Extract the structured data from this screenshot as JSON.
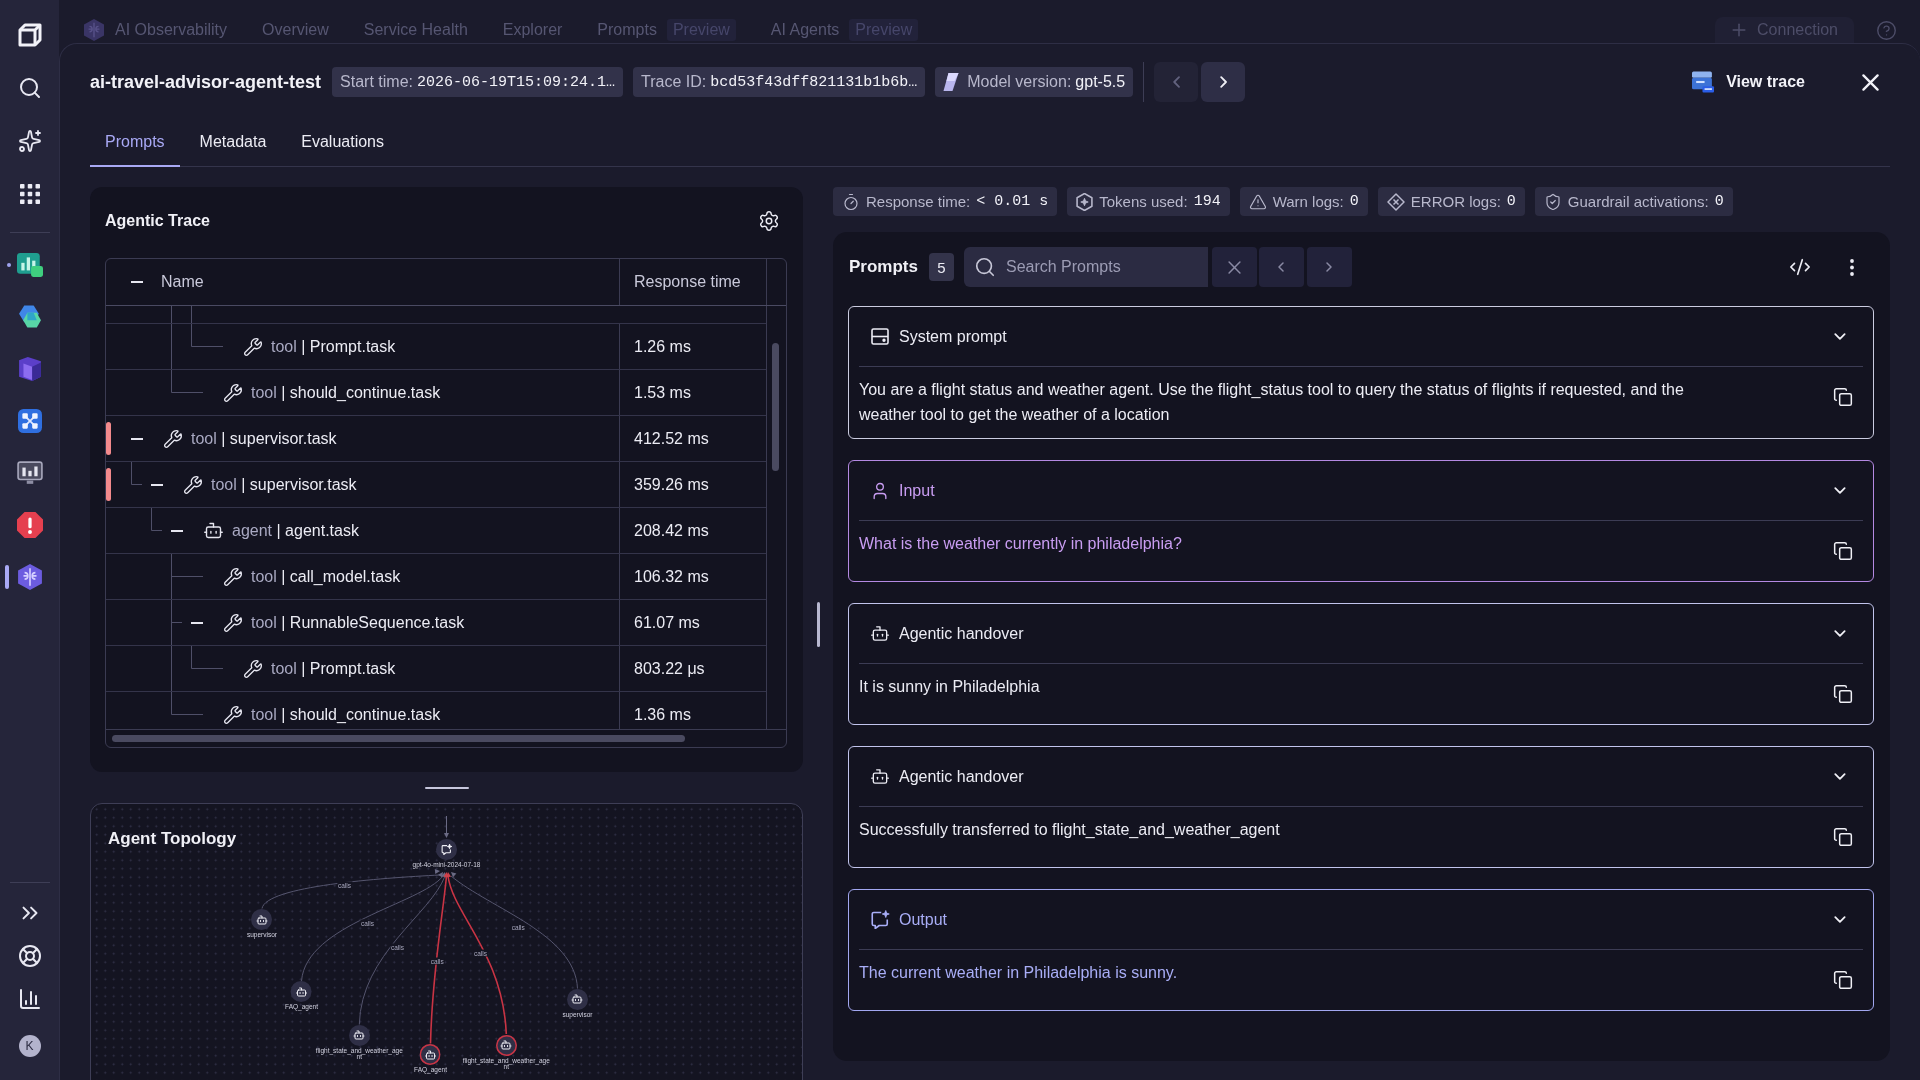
{
  "sidebar": {
    "apps": [
      {
        "selected": false,
        "open": true
      },
      {
        "selected": false,
        "open": false
      },
      {
        "selected": false,
        "open": false
      },
      {
        "selected": false,
        "open": false
      },
      {
        "selected": false,
        "open": false
      },
      {
        "selected": false,
        "open": false
      },
      {
        "selected": true,
        "open": false
      }
    ],
    "avatar": "K"
  },
  "top_nav": {
    "title": "AI Observability",
    "items": [
      {
        "label": "Overview"
      },
      {
        "label": "Service Health"
      },
      {
        "label": "Explorer"
      },
      {
        "label": "Prompts",
        "badge": "Preview"
      },
      {
        "label": "AI Agents",
        "badge": "Preview"
      }
    ],
    "connection_button": "Connection"
  },
  "trace": {
    "title": "ai-travel-advisor-agent-test",
    "chips": [
      {
        "kind": "text",
        "label": "Start time:",
        "value": "2026-06-19T15:09:24.1…"
      },
      {
        "kind": "text",
        "label": "Trace ID:",
        "value": "bcd53f43dff821131b1b6b…"
      },
      {
        "kind": "model",
        "label": "Model version:",
        "value": "gpt-5.5"
      }
    ],
    "pager": [
      {
        "disabled": true
      },
      {
        "disabled": false
      }
    ],
    "view_trace_button": "View trace"
  },
  "tabs": [
    {
      "label": "Prompts",
      "selected": true
    },
    {
      "label": "Metadata",
      "selected": false
    },
    {
      "label": "Evaluations",
      "selected": false
    }
  ],
  "agentic_trace": {
    "title": "Agentic Trace",
    "columns": [
      "Name",
      "Response time"
    ],
    "rows": [
      {
        "children": [
          {
            "children": [
              {
                "children": [
                  {
                    "children": [
                      {
                        "kind": "tool",
                        "type": "tool",
                        "separator": "|",
                        "name": "Prompt.task",
                        "response_time": "1.26 ms",
                        "error": false
                      }
                    ]
                  },
                  {
                    "kind": "tool",
                    "type": "tool",
                    "separator": "|",
                    "name": "should_continue.task",
                    "response_time": "1.53 ms",
                    "error": false
                  }
                ]
              }
            ]
          }
        ]
      },
      {
        "kind": "tool",
        "type": "tool",
        "separator": "|",
        "name": "supervisor.task",
        "response_time": "412.52 ms",
        "error": true,
        "expanded": true,
        "children": [
          {
            "kind": "tool",
            "type": "tool",
            "separator": "|",
            "name": "supervisor.task",
            "response_time": "359.26 ms",
            "error": true,
            "expanded": true,
            "children": [
              {
                "kind": "agent",
                "type": "agent",
                "separator": "|",
                "name": "agent.task",
                "response_time": "208.42 ms",
                "error": false,
                "expanded": true,
                "children": [
                  {
                    "kind": "tool",
                    "type": "tool",
                    "separator": "|",
                    "name": "call_model.task",
                    "response_time": "106.32 ms",
                    "error": false
                  },
                  {
                    "kind": "tool",
                    "type": "tool",
                    "separator": "|",
                    "name": "RunnableSequence.task",
                    "response_time": "61.07 ms",
                    "error": false,
                    "expanded": true,
                    "children": [
                      {
                        "kind": "tool",
                        "type": "tool",
                        "separator": "|",
                        "name": "Prompt.task",
                        "response_time": "803.22 μs",
                        "error": false
                      }
                    ]
                  },
                  {
                    "kind": "tool",
                    "type": "tool",
                    "separator": "|",
                    "name": "should_continue.task",
                    "response_time": "1.36 ms",
                    "error": false
                  }
                ]
              }
            ]
          }
        ]
      }
    ]
  },
  "agent_topology": {
    "title": "Agent Topology",
    "nodes": [
      {
        "kind": "model",
        "label": "gpt-4o-mini-2024-07-18",
        "highlighted": false
      },
      {
        "kind": "agent",
        "label": "supervisor",
        "highlighted": false,
        "edge_label": "calls"
      },
      {
        "kind": "agent",
        "label": "FAQ_agent",
        "highlighted": false,
        "edge_label": "calls"
      },
      {
        "kind": "agent",
        "label": "flight_state_and_weather_agent",
        "highlighted": false,
        "edge_label": "calls"
      },
      {
        "kind": "agent",
        "label": "FAQ_agent",
        "highlighted": true,
        "edge_label": "calls"
      },
      {
        "kind": "agent",
        "label": "flight_state_and_weather_agent",
        "highlighted": true,
        "edge_label": "calls"
      },
      {
        "kind": "agent",
        "label": "supervisor",
        "highlighted": false,
        "edge_label": "calls"
      }
    ]
  },
  "metrics": [
    {
      "kind": "response_time",
      "label": "Response time:",
      "value": "< 0.01 s"
    },
    {
      "kind": "tokens",
      "label": "Tokens used:",
      "value": "194"
    },
    {
      "kind": "warn",
      "label": "Warn logs:",
      "value": "0"
    },
    {
      "kind": "error",
      "label": "ERROR logs:",
      "value": "0"
    },
    {
      "kind": "guardrail",
      "label": "Guardrail activations:",
      "value": "0"
    }
  ],
  "prompts": {
    "title": "Prompts",
    "count": "5",
    "search_placeholder": "Search Prompts",
    "cards": [
      {
        "kind": "system",
        "title": "System prompt",
        "expanded": true,
        "text": "You are a flight status and weather agent. Use the flight_status tool to query the status of flights if requested, and the weather tool to get the weather of a location"
      },
      {
        "kind": "input",
        "title": "Input",
        "expanded": true,
        "text": "What is the weather currently in philadelphia?"
      },
      {
        "kind": "handover",
        "title": "Agentic handover",
        "expanded": true,
        "text": "It is sunny in Philadelphia"
      },
      {
        "kind": "handover",
        "title": "Agentic handover",
        "expanded": true,
        "text": "Successfully transferred to flight_state_and_weather_agent"
      },
      {
        "kind": "output",
        "title": "Output",
        "expanded": true,
        "text": "The current weather in Philadelphia is sunny."
      }
    ]
  }
}
